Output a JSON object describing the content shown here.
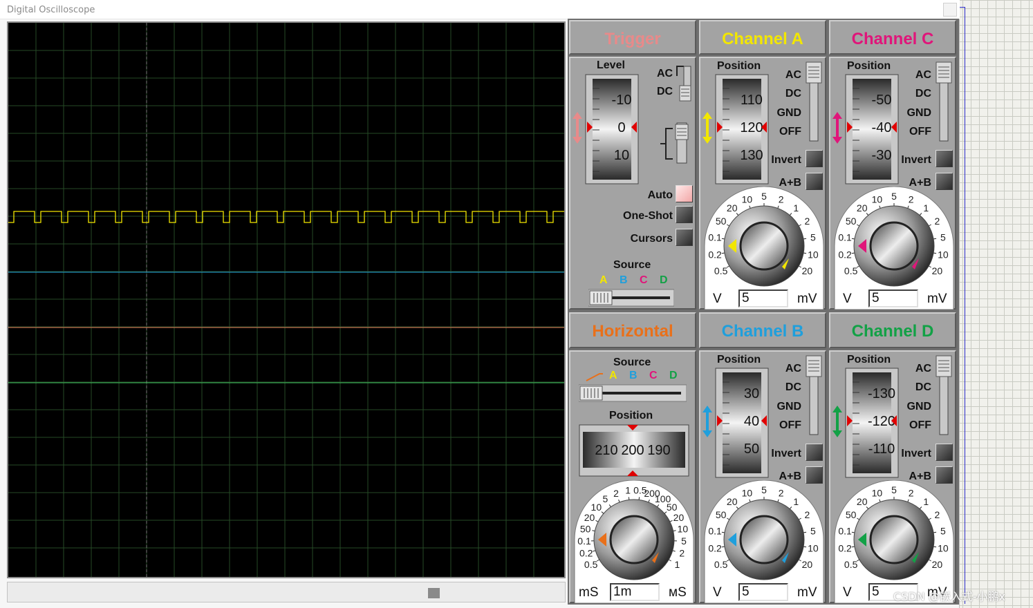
{
  "window": {
    "title": "Digital Oscilloscope"
  },
  "watermark": "CSDN @嵌入式-小鹏x",
  "colors": {
    "A": "#f2e600",
    "B": "#1f9fdc",
    "C": "#e0157a",
    "D": "#12a146",
    "trigger": "#e88a8a",
    "horizontal": "#e9701a"
  },
  "trigger": {
    "title": "Trigger",
    "level_label": "Level",
    "level_ticks": [
      "-10",
      "0",
      "10"
    ],
    "coupling": [
      "AC",
      "DC"
    ],
    "auto_label": "Auto",
    "oneshot_label": "One-Shot",
    "cursors_label": "Cursors",
    "source_label": "Source",
    "source_channels": [
      "A",
      "B",
      "C",
      "D"
    ]
  },
  "horizontal": {
    "title": "Horizontal",
    "source_label": "Source",
    "source_channels": [
      "A",
      "B",
      "C",
      "D"
    ],
    "position_label": "Position",
    "position_ticks": [
      "210",
      "200",
      "190"
    ],
    "dial_labels": [
      "0.5",
      "0.2",
      "0.1",
      "50",
      "20",
      "10",
      "5",
      "2",
      "1",
      "0.5",
      "200",
      "100",
      "50",
      "20",
      "10",
      "5",
      "2",
      "1"
    ],
    "unit_left": "mS",
    "unit_right": "мS",
    "value": "1m",
    "knob_color": "#e9701a"
  },
  "channels": [
    {
      "key": "A",
      "title": "Channel A",
      "position_label": "Position",
      "ticks": [
        "110",
        "120",
        "130"
      ],
      "value": "5",
      "color": "#f2e600"
    },
    {
      "key": "C",
      "title": "Channel C",
      "position_label": "Position",
      "ticks": [
        "-50",
        "-40",
        "-30"
      ],
      "value": "5",
      "color": "#e0157a"
    },
    {
      "key": "B",
      "title": "Channel B",
      "position_label": "Position",
      "ticks": [
        "30",
        "40",
        "50"
      ],
      "value": "5",
      "color": "#1f9fdc"
    },
    {
      "key": "D",
      "title": "Channel D",
      "position_label": "Position",
      "ticks": [
        "-130",
        "-120",
        "-110"
      ],
      "value": "5",
      "color": "#12a146"
    }
  ],
  "channel_common": {
    "coupling": [
      "AC",
      "DC",
      "GND",
      "OFF"
    ],
    "invert_label": "Invert",
    "aplusb_label": "A+B",
    "dial_labels": [
      "0.5",
      "0.2",
      "0.1",
      "50",
      "20",
      "10",
      "5",
      "2",
      "1",
      "2",
      "5",
      "10",
      "20"
    ],
    "unit_left": "V",
    "unit_right": "mV"
  }
}
